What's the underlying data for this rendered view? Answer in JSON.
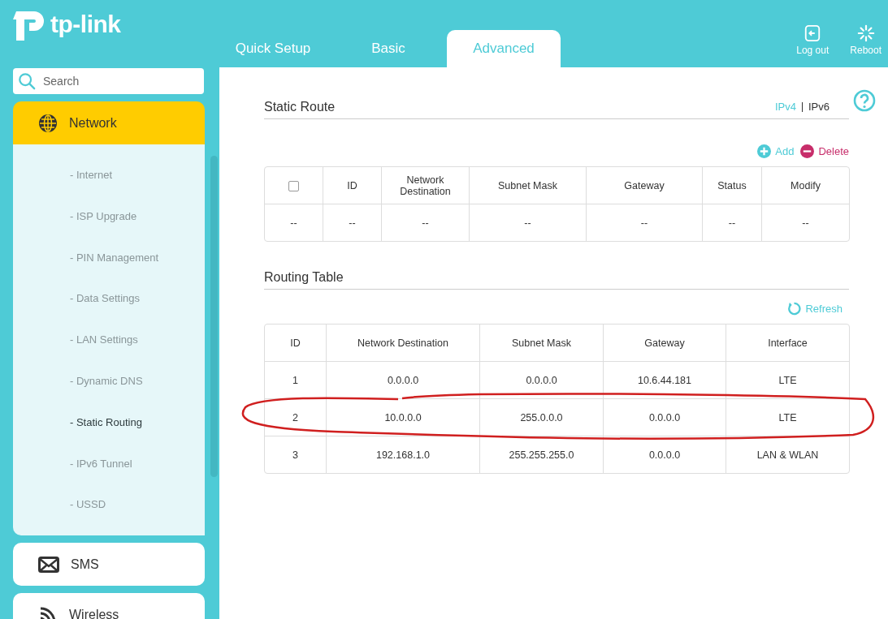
{
  "logo": {
    "text": "tp-link"
  },
  "tabs": [
    {
      "label": "Quick Setup",
      "selected": false
    },
    {
      "label": "Basic",
      "selected": false
    },
    {
      "label": "Advanced",
      "selected": true
    }
  ],
  "header_actions": [
    {
      "label": "Log out"
    },
    {
      "label": "Reboot"
    }
  ],
  "search": {
    "placeholder": "Search"
  },
  "sidebar": {
    "items": [
      {
        "label": "Network",
        "selected": true,
        "expanded": true,
        "children": [
          {
            "label": "- Internet",
            "selected": false
          },
          {
            "label": "- ISP Upgrade",
            "selected": false
          },
          {
            "label": "- PIN Management",
            "selected": false
          },
          {
            "label": "- Data Settings",
            "selected": false
          },
          {
            "label": "- LAN Settings",
            "selected": false
          },
          {
            "label": "- Dynamic DNS",
            "selected": false
          },
          {
            "label": "- Static Routing",
            "selected": true
          },
          {
            "label": "- IPv6 Tunnel",
            "selected": false
          },
          {
            "label": "- USSD",
            "selected": false
          }
        ]
      },
      {
        "label": "SMS",
        "selected": false,
        "expanded": false
      },
      {
        "label": "Wireless",
        "selected": false,
        "expanded": false
      }
    ]
  },
  "static_route": {
    "title": "Static Route",
    "versions": [
      {
        "label": "IPv4",
        "selected": true
      },
      {
        "label": "IPv6",
        "selected": false
      }
    ],
    "add": "Add",
    "delete": "Delete",
    "select_all_checked": false,
    "columns": [
      "",
      "ID",
      "Network Destination",
      "Subnet Mask",
      "Gateway",
      "Status",
      "Modify"
    ],
    "rows": [
      [
        "--",
        "--",
        "--",
        "--",
        "--",
        "--",
        "--"
      ]
    ]
  },
  "routing_table": {
    "title": "Routing Table",
    "refresh": "Refresh",
    "columns": [
      "ID",
      "Network Destination",
      "Subnet Mask",
      "Gateway",
      "Interface"
    ],
    "rows": [
      [
        "1",
        "0.0.0.0",
        "0.0.0.0",
        "10.6.44.181",
        "LTE"
      ],
      [
        "2",
        "10.0.0.0",
        "255.0.0.0",
        "0.0.0.0",
        "LTE"
      ],
      [
        "3",
        "192.168.1.0",
        "255.255.255.0",
        "0.0.0.0",
        "LAN & WLAN"
      ]
    ]
  }
}
